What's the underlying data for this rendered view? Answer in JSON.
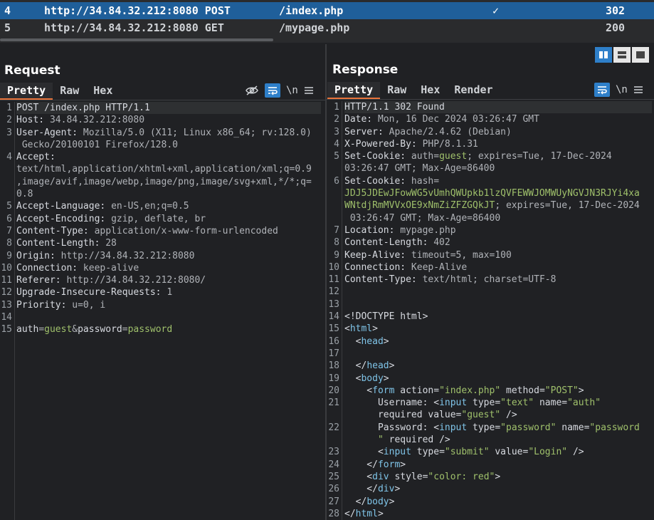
{
  "history": {
    "rows": [
      {
        "id": "4",
        "host": "http://34.84.32.212:8080",
        "method": "POST",
        "path": "/index.php",
        "check": "✓",
        "status": "302"
      },
      {
        "id": "5",
        "host": "http://34.84.32.212:8080",
        "method": "GET",
        "path": "/mypage.php",
        "check": "",
        "status": "200"
      }
    ]
  },
  "request": {
    "title": "Request",
    "tabs": [
      "Pretty",
      "Raw",
      "Hex"
    ],
    "active_tab": "Pretty",
    "lines": [
      {
        "n": "1",
        "parts": [
          [
            "k",
            "POST /index.php HTTP/1.1"
          ]
        ]
      },
      {
        "n": "2",
        "parts": [
          [
            "k",
            "Host: "
          ],
          [
            "v",
            "34.84.32.212:8080"
          ]
        ]
      },
      {
        "n": "3",
        "parts": [
          [
            "k",
            "User-Agent: "
          ],
          [
            "v",
            "Mozilla/5.0 (X11; Linux x86_64; rv:128.0)"
          ]
        ]
      },
      {
        "n": "",
        "parts": [
          [
            "v",
            " Gecko/20100101 Firefox/128.0"
          ]
        ]
      },
      {
        "n": "4",
        "parts": [
          [
            "k",
            "Accept:"
          ]
        ]
      },
      {
        "n": "",
        "parts": [
          [
            "v",
            "text/html,application/xhtml+xml,application/xml;q=0.9"
          ]
        ]
      },
      {
        "n": "",
        "parts": [
          [
            "v",
            ",image/avif,image/webp,image/png,image/svg+xml,*/*;q="
          ]
        ]
      },
      {
        "n": "",
        "parts": [
          [
            "v",
            "0.8"
          ]
        ]
      },
      {
        "n": "5",
        "parts": [
          [
            "k",
            "Accept-Language: "
          ],
          [
            "v",
            "en-US,en;q=0.5"
          ]
        ]
      },
      {
        "n": "6",
        "parts": [
          [
            "k",
            "Accept-Encoding: "
          ],
          [
            "v",
            "gzip, deflate, br"
          ]
        ]
      },
      {
        "n": "7",
        "parts": [
          [
            "k",
            "Content-Type: "
          ],
          [
            "v",
            "application/x-www-form-urlencoded"
          ]
        ]
      },
      {
        "n": "8",
        "parts": [
          [
            "k",
            "Content-Length: "
          ],
          [
            "v",
            "28"
          ]
        ]
      },
      {
        "n": "9",
        "parts": [
          [
            "k",
            "Origin: "
          ],
          [
            "v",
            "http://34.84.32.212:8080"
          ]
        ]
      },
      {
        "n": "10",
        "parts": [
          [
            "k",
            "Connection: "
          ],
          [
            "v",
            "keep-alive"
          ]
        ]
      },
      {
        "n": "11",
        "parts": [
          [
            "k",
            "Referer: "
          ],
          [
            "v",
            "http://34.84.32.212:8080/"
          ]
        ]
      },
      {
        "n": "12",
        "parts": [
          [
            "k",
            "Upgrade-Insecure-Requests: "
          ],
          [
            "v",
            "1"
          ]
        ]
      },
      {
        "n": "13",
        "parts": [
          [
            "k",
            "Priority: "
          ],
          [
            "v",
            "u=0, i"
          ]
        ]
      },
      {
        "n": "14",
        "parts": []
      },
      {
        "n": "15",
        "parts": [
          [
            "k",
            "auth"
          ],
          [
            "v",
            "="
          ],
          [
            "g",
            "guest"
          ],
          [
            "v",
            "&"
          ],
          [
            "k",
            "password"
          ],
          [
            "v",
            "="
          ],
          [
            "g",
            "password"
          ]
        ]
      }
    ]
  },
  "response": {
    "title": "Response",
    "tabs": [
      "Pretty",
      "Raw",
      "Hex",
      "Render"
    ],
    "active_tab": "Pretty",
    "lines": [
      {
        "n": "1",
        "parts": [
          [
            "k",
            "HTTP/1.1 302 Found"
          ]
        ]
      },
      {
        "n": "2",
        "parts": [
          [
            "k",
            "Date: "
          ],
          [
            "v",
            "Mon, 16 Dec 2024 03:26:47 GMT"
          ]
        ]
      },
      {
        "n": "3",
        "parts": [
          [
            "k",
            "Server: "
          ],
          [
            "v",
            "Apache/2.4.62 (Debian)"
          ]
        ]
      },
      {
        "n": "4",
        "parts": [
          [
            "k",
            "X-Powered-By: "
          ],
          [
            "v",
            "PHP/8.1.31"
          ]
        ]
      },
      {
        "n": "5",
        "parts": [
          [
            "k",
            "Set-Cookie: "
          ],
          [
            "v",
            "auth="
          ],
          [
            "g",
            "guest"
          ],
          [
            "v",
            "; expires=Tue, 17-Dec-2024"
          ]
        ]
      },
      {
        "n": "",
        "parts": [
          [
            "v",
            "03:26:47 GMT; Max-Age=86400"
          ]
        ]
      },
      {
        "n": "6",
        "parts": [
          [
            "k",
            "Set-Cookie: "
          ],
          [
            "v",
            "hash="
          ]
        ]
      },
      {
        "n": "",
        "parts": [
          [
            "g",
            "JDJ5JDEwJFowWG5vUmhQWUpkb1lzQVFEWWJOMWUyNGVJN3RJYi4xa"
          ]
        ]
      },
      {
        "n": "",
        "parts": [
          [
            "g",
            "WNtdjRmMVVxOE9xNmZiZFZGQkJT"
          ],
          [
            "v",
            "; expires=Tue, 17-Dec-2024"
          ]
        ]
      },
      {
        "n": "",
        "parts": [
          [
            "v",
            " 03:26:47 GMT; Max-Age=86400"
          ]
        ]
      },
      {
        "n": "7",
        "parts": [
          [
            "k",
            "Location: "
          ],
          [
            "v",
            "mypage.php"
          ]
        ]
      },
      {
        "n": "8",
        "parts": [
          [
            "k",
            "Content-Length: "
          ],
          [
            "v",
            "402"
          ]
        ]
      },
      {
        "n": "9",
        "parts": [
          [
            "k",
            "Keep-Alive: "
          ],
          [
            "v",
            "timeout=5, max=100"
          ]
        ]
      },
      {
        "n": "10",
        "parts": [
          [
            "k",
            "Connection: "
          ],
          [
            "v",
            "Keep-Alive"
          ]
        ]
      },
      {
        "n": "11",
        "parts": [
          [
            "k",
            "Content-Type: "
          ],
          [
            "v",
            "text/html; charset=UTF-8"
          ]
        ]
      },
      {
        "n": "12",
        "parts": []
      },
      {
        "n": "13",
        "parts": []
      },
      {
        "n": "14",
        "parts": [
          [
            "k",
            "<!DOCTYPE html>"
          ]
        ]
      },
      {
        "n": "15",
        "parts": [
          [
            "k",
            "<"
          ],
          [
            "t",
            "html"
          ],
          [
            "k",
            ">"
          ]
        ]
      },
      {
        "n": "16",
        "parts": [
          [
            "k",
            "  <"
          ],
          [
            "t",
            "head"
          ],
          [
            "k",
            ">"
          ]
        ]
      },
      {
        "n": "17",
        "parts": []
      },
      {
        "n": "18",
        "parts": [
          [
            "k",
            "  </"
          ],
          [
            "t",
            "head"
          ],
          [
            "k",
            ">"
          ]
        ]
      },
      {
        "n": "19",
        "parts": [
          [
            "k",
            "  <"
          ],
          [
            "t",
            "body"
          ],
          [
            "k",
            ">"
          ]
        ]
      },
      {
        "n": "20",
        "parts": [
          [
            "k",
            "    <"
          ],
          [
            "t",
            "form"
          ],
          [
            "k",
            " action="
          ],
          [
            "s",
            "\"index.php\""
          ],
          [
            "k",
            " method="
          ],
          [
            "s",
            "\"POST\""
          ],
          [
            "k",
            ">"
          ]
        ]
      },
      {
        "n": "21",
        "parts": [
          [
            "k",
            "      Username: <"
          ],
          [
            "t",
            "input"
          ],
          [
            "k",
            " type="
          ],
          [
            "s",
            "\"text\""
          ],
          [
            "k",
            " name="
          ],
          [
            "s",
            "\"auth\""
          ]
        ]
      },
      {
        "n": "",
        "parts": [
          [
            "k",
            "      required value="
          ],
          [
            "s",
            "\"guest\""
          ],
          [
            "k",
            " />"
          ]
        ]
      },
      {
        "n": "22",
        "parts": [
          [
            "k",
            "      Password: <"
          ],
          [
            "t",
            "input"
          ],
          [
            "k",
            " type="
          ],
          [
            "s",
            "\"password\""
          ],
          [
            "k",
            " name="
          ],
          [
            "s",
            "\"password"
          ]
        ]
      },
      {
        "n": "",
        "parts": [
          [
            "s",
            "      \""
          ],
          [
            "k",
            " required />"
          ]
        ]
      },
      {
        "n": "23",
        "parts": [
          [
            "k",
            "      <"
          ],
          [
            "t",
            "input"
          ],
          [
            "k",
            " type="
          ],
          [
            "s",
            "\"submit\""
          ],
          [
            "k",
            " value="
          ],
          [
            "s",
            "\"Login\""
          ],
          [
            "k",
            " />"
          ]
        ]
      },
      {
        "n": "24",
        "parts": [
          [
            "k",
            "    </"
          ],
          [
            "t",
            "form"
          ],
          [
            "k",
            ">"
          ]
        ]
      },
      {
        "n": "25",
        "parts": [
          [
            "k",
            "    <"
          ],
          [
            "t",
            "div"
          ],
          [
            "k",
            " style="
          ],
          [
            "s",
            "\"color: red\""
          ],
          [
            "k",
            ">"
          ]
        ]
      },
      {
        "n": "26",
        "parts": [
          [
            "k",
            "    </"
          ],
          [
            "t",
            "div"
          ],
          [
            "k",
            ">"
          ]
        ]
      },
      {
        "n": "27",
        "parts": [
          [
            "k",
            "  </"
          ],
          [
            "t",
            "body"
          ],
          [
            "k",
            ">"
          ]
        ]
      },
      {
        "n": "28",
        "parts": [
          [
            "k",
            "</"
          ],
          [
            "t",
            "html"
          ],
          [
            "k",
            ">"
          ]
        ]
      }
    ]
  },
  "toolbar": {
    "newline_label": "\\n"
  }
}
